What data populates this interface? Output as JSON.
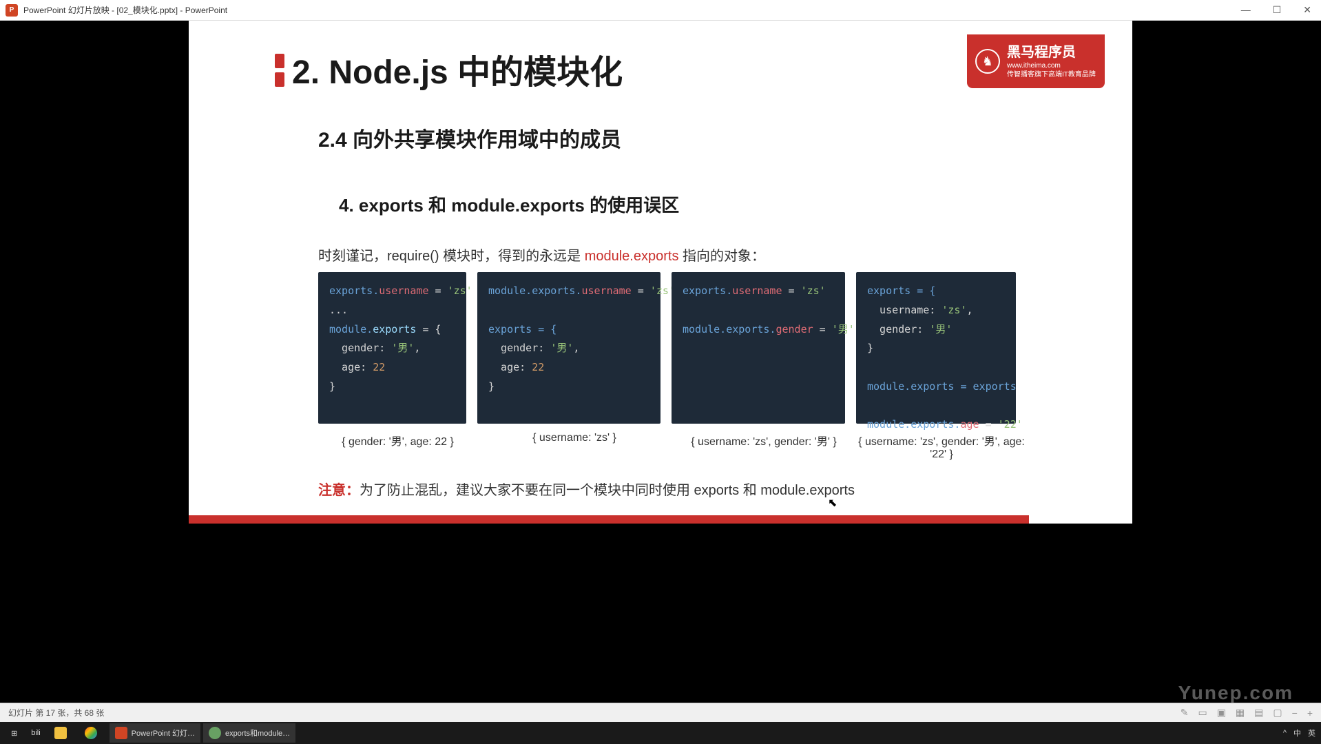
{
  "titlebar": {
    "app_icon_letter": "P",
    "title": "PowerPoint 幻灯片放映 - [02_模块化.pptx] - PowerPoint",
    "minimize": "—",
    "maximize": "☐",
    "close": "✕"
  },
  "slide": {
    "title": "2. Node.js 中的模块化",
    "section": "2.4 向外共享模块作用域中的成员",
    "subsection": "4. exports 和 module.exports 的使用误区",
    "desc_prefix": "时刻谨记，require() 模块时，得到的永远是 ",
    "desc_red": "module.exports",
    "desc_suffix": " 指向的对象：",
    "note_red": "注意：",
    "note_text": "为了防止混乱，建议大家不要在同一个模块中同时使用 exports 和 module.exports"
  },
  "brand": {
    "main": "黑马程序员",
    "url": "www.itheima.com",
    "slogan": "传智播客旗下高端IT教育品牌"
  },
  "code": {
    "c1_l1a": "exports.",
    "c1_l1b": "username",
    "c1_l1c": " = ",
    "c1_l1d": "'zs'",
    "c1_l2": "...",
    "c1_l3a": "module.",
    "c1_l3b": "exports",
    "c1_l3c": " = {",
    "c1_l4a": "  gender: ",
    "c1_l4b": "'男'",
    "c1_l4c": ",",
    "c1_l5a": "  age: ",
    "c1_l5b": "22",
    "c1_l6": "}",
    "c2_l1a": "module.exports.",
    "c2_l1b": "username",
    "c2_l1c": " = ",
    "c2_l1d": "'zs'",
    "c2_l3a": "exports = {",
    "c2_l4a": "  gender: ",
    "c2_l4b": "'男'",
    "c2_l4c": ",",
    "c2_l5a": "  age: ",
    "c2_l5b": "22",
    "c2_l6": "}",
    "c3_l1a": "exports.",
    "c3_l1b": "username",
    "c3_l1c": " = ",
    "c3_l1d": "'zs'",
    "c3_l3a": "module.exports.",
    "c3_l3b": "gender",
    "c3_l3c": " = ",
    "c3_l3d": "'男'",
    "c4_l1": "exports = {",
    "c4_l2a": "  username: ",
    "c4_l2b": "'zs'",
    "c4_l2c": ",",
    "c4_l3a": "  gender: ",
    "c4_l3b": "'男'",
    "c4_l4": "}",
    "c4_l6": "module.exports = exports",
    "c4_l8a": "module.exports.",
    "c4_l8b": "age",
    "c4_l8c": " = ",
    "c4_l8d": "'22'"
  },
  "outputs": {
    "o1": "{ gender: '男', age: 22 }",
    "o2": "{ username: 'zs' }",
    "o3": "{ username: 'zs', gender: '男' }",
    "o4": "{ username: 'zs', gender: '男', age: '22' }"
  },
  "statusbar": {
    "left": "幻灯片 第 17 张，共 68 张"
  },
  "taskbar": {
    "start": "⊞",
    "bili": "bili",
    "t1": "PowerPoint 幻灯…",
    "t2": "exports和module…",
    "watermark_text": "Yunep.com",
    "lang1": "中",
    "lang2": "英"
  }
}
